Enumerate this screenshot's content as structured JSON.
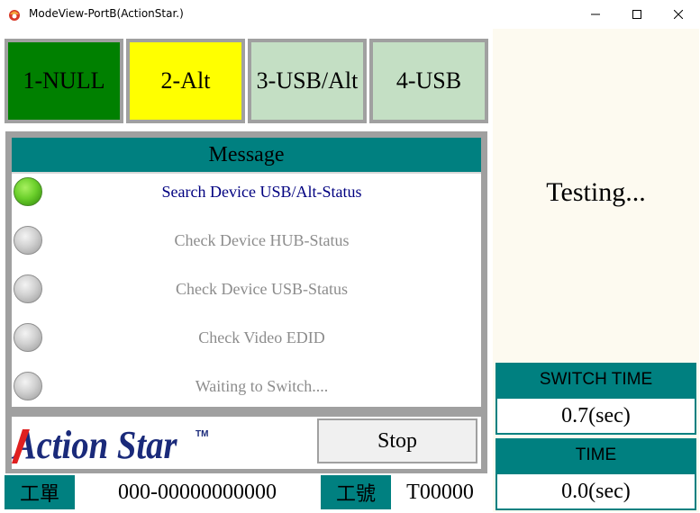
{
  "window": {
    "title": "ModeView-PortB(ActionStar.)"
  },
  "modes": [
    {
      "label": "1-NULL",
      "color": "#008000"
    },
    {
      "label": "2-Alt",
      "color": "#ffff00"
    },
    {
      "label": "3-USB/Alt",
      "color": "#c4dfc4"
    },
    {
      "label": "4-USB",
      "color": "#c4dfc4"
    }
  ],
  "message": {
    "header": "Message",
    "items": [
      {
        "text": "Search Device USB/Alt-Status",
        "status": "active"
      },
      {
        "text": "Check Device HUB-Status",
        "status": "inactive"
      },
      {
        "text": "Check Device USB-Status",
        "status": "inactive"
      },
      {
        "text": "Check Video EDID",
        "status": "inactive"
      },
      {
        "text": "Waiting to Switch....",
        "status": "inactive"
      }
    ]
  },
  "brand": {
    "name": "Action Star",
    "trademark": "TM",
    "color_primary": "#1a2a7a",
    "color_accent": "#e02020"
  },
  "stop_label": "Stop",
  "footer": {
    "work_order_label": "工單",
    "work_order_value": "000-00000000000",
    "serial_label": "工號",
    "serial_value": "T00000"
  },
  "status": {
    "text": "Testing..."
  },
  "switch_time": {
    "label": "SWITCH TIME",
    "value": "0.7(sec)"
  },
  "time": {
    "label": "TIME",
    "value": "0.0(sec)"
  },
  "colors": {
    "teal": "#008080",
    "frame_gray": "#a0a0a0",
    "panel_bg": "#fdfaf0",
    "active_text": "#000080",
    "inactive_text": "#8c8c8c"
  }
}
